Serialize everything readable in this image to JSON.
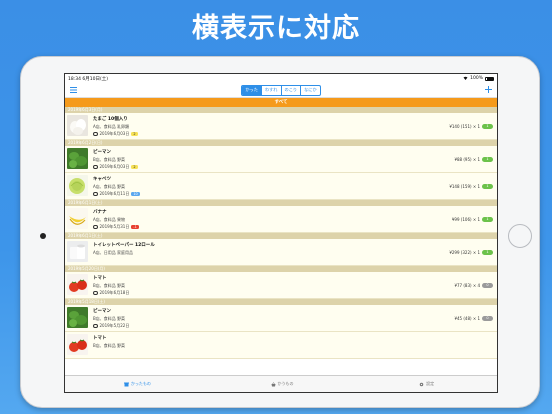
{
  "headline": "横表示に対応",
  "status": {
    "time": "18:34",
    "date": "6月10日(土)",
    "wifi_icon": "wifi-icon",
    "battery": "100%"
  },
  "navbar": {
    "menu_icon": "hamburger-menu-icon",
    "add_icon": "plus-icon",
    "segments": [
      "かった",
      "わすれ",
      "のこり",
      "なにか"
    ],
    "active_segment": 0
  },
  "filter": {
    "label": "すべて"
  },
  "sections": [
    {
      "date": "2019年6月3日(月)",
      "items": [
        {
          "name": "たまご 10個入り",
          "category": "A店、食料品 乳卵類",
          "expiry": "2019年6月03日",
          "badge": "2",
          "badge_color": "yellow",
          "price": "¥140 (151) × 1",
          "pill": "1",
          "pill_color": "green",
          "image": "eggs"
        }
      ]
    },
    {
      "date": "2019年6月2日(日)",
      "items": [
        {
          "name": "ピーマン",
          "category": "B店、食料品 野菜",
          "expiry": "2019年6月03日",
          "badge": "2",
          "badge_color": "yellow",
          "price": "¥88 (95) × 1",
          "pill": "1",
          "pill_color": "green",
          "image": "pepper"
        },
        {
          "name": "キャベツ",
          "category": "A店、食料品 野菜",
          "expiry": "2019年6月11日",
          "badge": "10",
          "badge_color": "blue",
          "price": "¥148 (159) × 1",
          "pill": "1",
          "pill_color": "green",
          "image": "cabbage"
        }
      ]
    },
    {
      "date": "2019年6月1日(土)",
      "items": [
        {
          "name": "バナナ",
          "category": "A店、食料品 果物",
          "expiry": "2019年5月31日",
          "badge": "-1",
          "badge_color": "red",
          "price": "¥99 (106) × 1",
          "pill": "1",
          "pill_color": "green",
          "image": "banana"
        }
      ]
    },
    {
      "date": "2019年6月1日(土)",
      "items": [
        {
          "name": "トイレットペーパー 12ロール",
          "category": "A店、日用品 家庭用品",
          "expiry": "",
          "badge": "",
          "badge_color": "",
          "price": "¥299 (322) × 1",
          "pill": "1",
          "pill_color": "green",
          "image": "toilet"
        }
      ]
    },
    {
      "date": "2019年5月20日(月)",
      "items": [
        {
          "name": "トマト",
          "category": "B店、食料品 野菜",
          "expiry": "2019年6月18日",
          "badge": "",
          "badge_color": "",
          "price": "¥77 (83) × 4",
          "pill": "0",
          "pill_color": "gray",
          "image": "tomato"
        }
      ]
    },
    {
      "date": "2019年5月18日(土)",
      "items": [
        {
          "name": "ピーマン",
          "category": "B店、食料品 野菜",
          "expiry": "2019年5月22日",
          "badge": "",
          "badge_color": "",
          "price": "¥45 (48) × 1",
          "pill": "0",
          "pill_color": "gray",
          "image": "pepper"
        },
        {
          "name": "トマト",
          "category": "B店、食料品 野菜",
          "expiry": "",
          "badge": "",
          "badge_color": "",
          "price": "",
          "pill": "",
          "pill_color": "",
          "image": "tomato"
        }
      ]
    }
  ],
  "tabbar": [
    {
      "label": "かったもの",
      "icon": "store-icon",
      "active": true
    },
    {
      "label": "かうもの",
      "icon": "basket-icon",
      "active": false
    },
    {
      "label": "設定",
      "icon": "gear-icon",
      "active": false
    }
  ]
}
